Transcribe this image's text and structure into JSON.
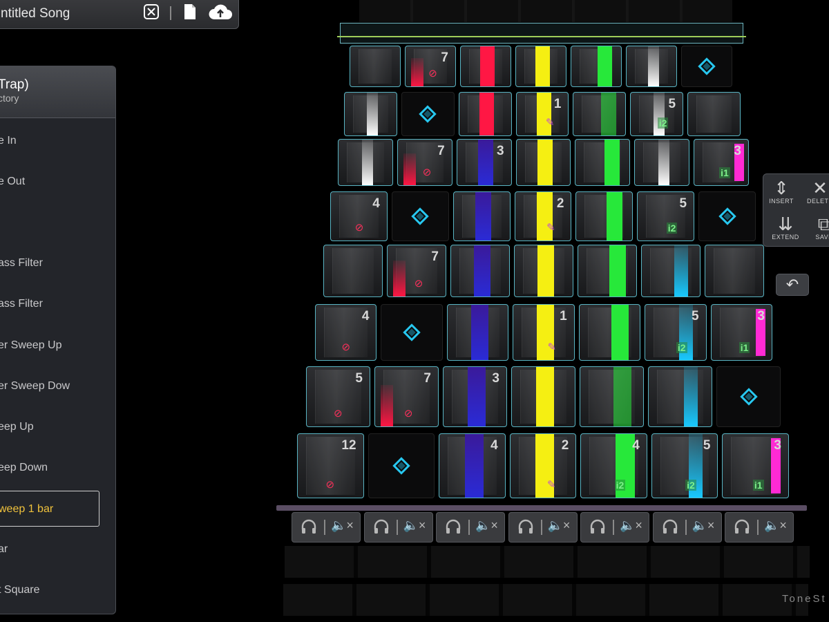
{
  "title_bar": {
    "song_title": "ntitled Song",
    "close_icon": "close-box-icon",
    "file_icon": "file-icon",
    "upload_icon": "cloud-upload-icon"
  },
  "preset_panel": {
    "pack_name": "Trap)",
    "pack_source": "ctory",
    "presets": [
      "e In",
      "e Out",
      "",
      "ass Filter",
      "ass Filter",
      "er Sweep Up",
      "er Sweep Dow",
      "eep Up",
      "eep Down",
      "weep 1 bar",
      "ar",
      "t Square"
    ],
    "selected_index": 9
  },
  "tools": {
    "insert": "INSERT",
    "delete": "DELETE",
    "extend": "EXTEND",
    "save": "SAVE"
  },
  "grid": {
    "rows": [
      [
        "",
        "7",
        "",
        "",
        "",
        "",
        ""
      ],
      [
        "",
        "",
        "",
        "1",
        "",
        "5",
        ""
      ],
      [
        "",
        "7",
        "3",
        "",
        "",
        "",
        "3"
      ],
      [
        "4",
        "",
        "",
        "2",
        "",
        "5",
        ""
      ],
      [
        "",
        "7",
        "",
        "",
        "",
        "",
        ""
      ],
      [
        "4",
        "",
        "",
        "1",
        "",
        "5",
        "3"
      ],
      [
        "5",
        "7",
        "3",
        "",
        "",
        "",
        ""
      ],
      [
        "12",
        "",
        "4",
        "2",
        "4",
        "5",
        "3"
      ]
    ],
    "track_colors": [
      "#ff1744",
      "#2a2bd6",
      "#f5ef12",
      "#27e83a",
      "#19c9ff",
      "#ff2ad4"
    ]
  },
  "channels": {
    "count": 7,
    "headphone_icon": "headphones-icon",
    "mute_icon": "speaker-mute-icon"
  },
  "brand": "ToneSt"
}
